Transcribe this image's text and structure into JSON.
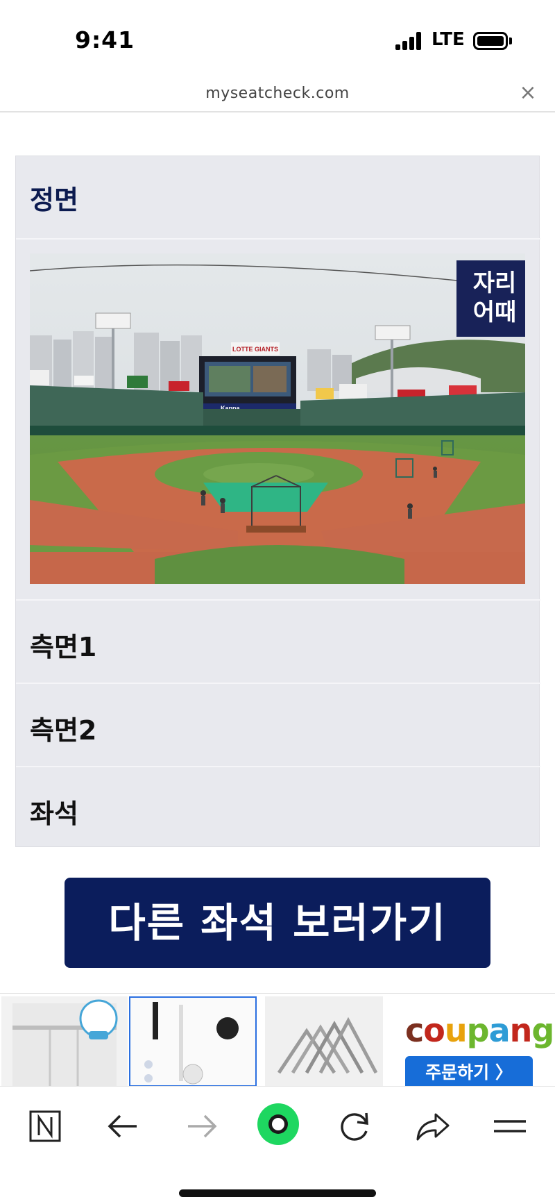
{
  "status_bar": {
    "time": "9:41",
    "network": "LTE"
  },
  "browser": {
    "url": "myseatcheck.com",
    "close_glyph": "×"
  },
  "sections": {
    "front": "정면",
    "side1": "측면1",
    "side2": "측면2",
    "seat": "좌석"
  },
  "photo": {
    "badge_line1": "자리",
    "badge_line2": "어때",
    "scoreboard_text": "LOTTE GIANTS",
    "sponsor_text": "Kappa"
  },
  "cta": {
    "label": "다른 좌석 보러가기"
  },
  "ads": {
    "coupang_logo": "coupang",
    "coupang_order": "주문하기 〉"
  },
  "toolbar": {
    "icons": [
      "naver-n-icon",
      "back-arrow-icon",
      "forward-arrow-icon",
      "green-dot-icon",
      "refresh-icon",
      "share-icon",
      "menu-icon"
    ]
  },
  "colors": {
    "primary_navy": "#0b1d5c",
    "panel_bg": "#e8e9ee",
    "badge_navy": "#182258",
    "coupang_button": "#176dd8",
    "toolbar_green": "#1ed760"
  }
}
